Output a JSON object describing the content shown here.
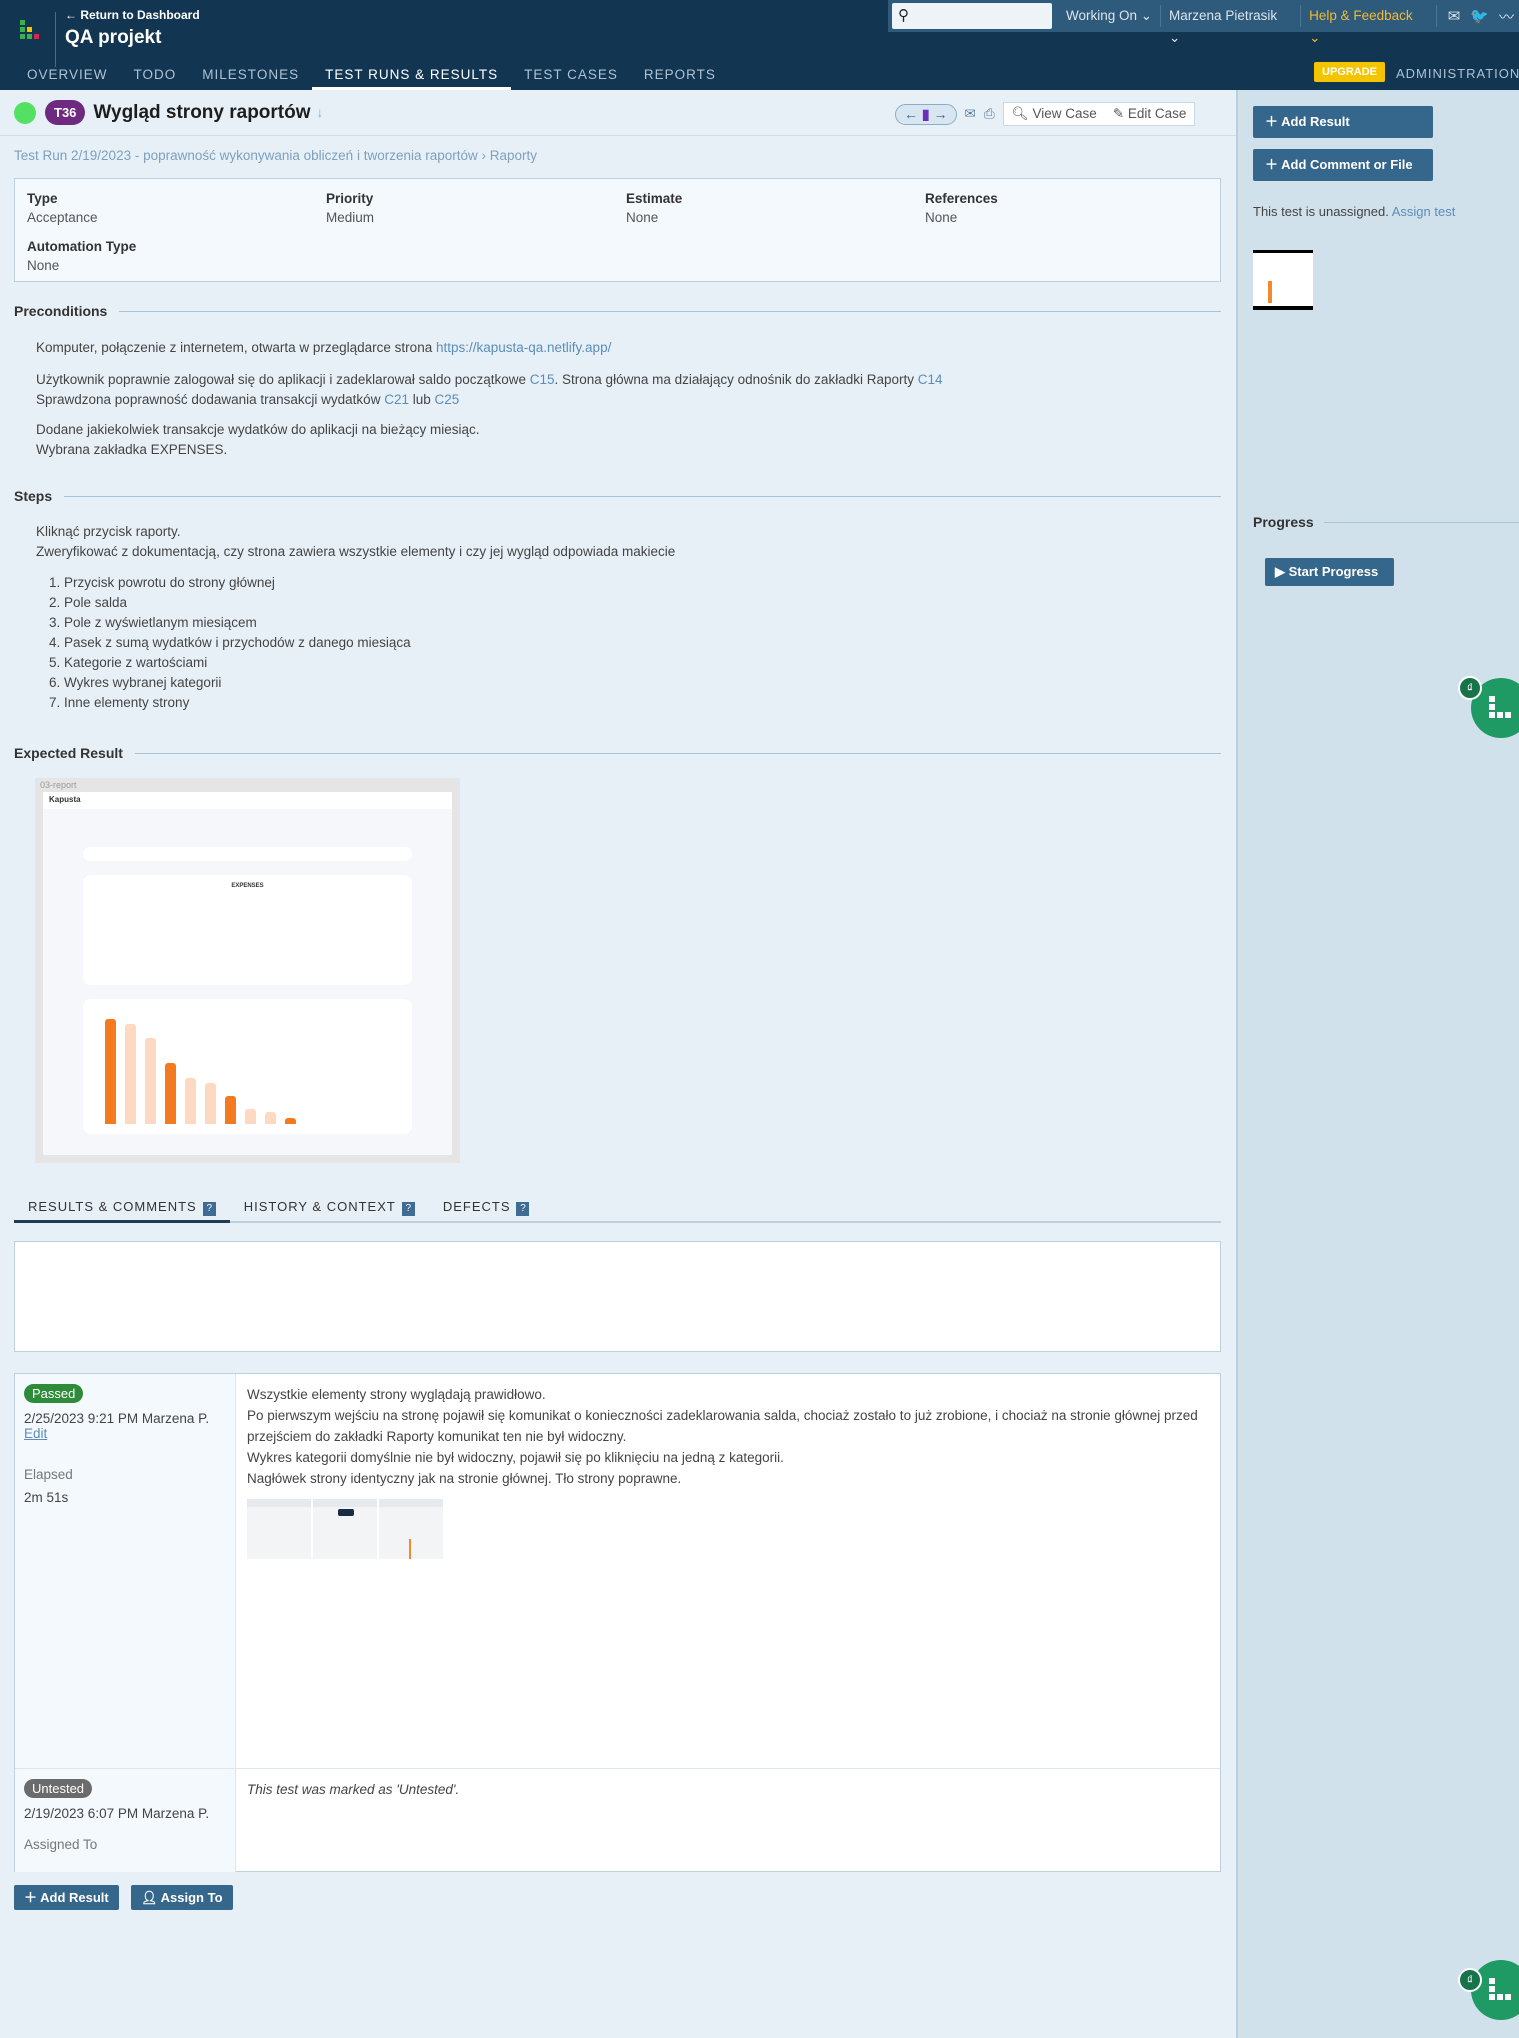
{
  "header": {
    "return_link": "← Return to Dashboard",
    "project": "QA projekt",
    "search_placeholder": "",
    "working_on": "Working On ⌄",
    "user": "Marzena Pietrasik ⌄",
    "help": "Help & Feedback ⌄",
    "upgrade": "UPGRADE",
    "administration": "ADMINISTRATION",
    "nav": [
      "OVERVIEW",
      "TODO",
      "MILESTONES",
      "TEST RUNS & RESULTS",
      "TEST CASES",
      "REPORTS"
    ]
  },
  "test": {
    "id": "T36",
    "title": "Wygląd strony raportów",
    "breadcrumb": "Test Run 2/19/2023 - poprawność wykonywania obliczeń i tworzenia raportów › Raporty",
    "view_case": "View Case",
    "edit_case": "Edit Case"
  },
  "fields": [
    {
      "label": "Type",
      "value": "Acceptance"
    },
    {
      "label": "Priority",
      "value": "Medium"
    },
    {
      "label": "Estimate",
      "value": "None"
    },
    {
      "label": "References",
      "value": "None"
    },
    {
      "label": "Automation Type",
      "value": "None"
    }
  ],
  "preconditions": {
    "heading": "Preconditions",
    "line1": "Komputer, połączenie z internetem, otwarta w przeglądarce strona ",
    "url": "https://kapusta-qa.netlify.app/",
    "line2a": "Użytkownik poprawnie zalogował się do aplikacji i zadeklarował saldo początkowe ",
    "c15": "C15",
    "line2b": ". Strona główna ma działający odnośnik do zakładki Raporty ",
    "c14": "C14",
    "line3a": "Sprawdzona poprawność dodawania transakcji wydatków ",
    "c21": "C21",
    "lub": " lub ",
    "c25": "C25",
    "line4": "Dodane jakiekolwiek transakcje wydatków do aplikacji na bieżący miesiąc.",
    "line5": "Wybrana zakładka EXPENSES."
  },
  "steps": {
    "heading": "Steps",
    "line1": "Kliknąć przycisk raporty.",
    "line2": "Zweryfikować z dokumentacją, czy strona zawiera wszystkie elementy i czy jej wygląd odpowiada makiecie",
    "items": [
      "Przycisk powrotu do strony głównej",
      "Pole salda",
      "Pole z wyświetlanym miesiącem",
      "Pasek z sumą wydatków i przychodów z danego miesiąca",
      "Kategorie z wartościami",
      "Wykres wybranej kategorii",
      "Inne elementy strony"
    ]
  },
  "expected": {
    "heading": "Expected Result",
    "image_label": "03-report",
    "logo": "Kapusta",
    "categories_title": "EXPENSES"
  },
  "tabs": [
    "RESULTS & COMMENTS",
    "HISTORY & CONTEXT",
    "DEFECTS"
  ],
  "results": [
    {
      "status": "Passed",
      "color": "#2e8b3a",
      "meta": "2/25/2023 9:21 PM Marzena P.",
      "edit": "Edit",
      "elapsed_label": "Elapsed",
      "elapsed": "2m 51s",
      "comment": [
        "Wszystkie elementy strony wyglądają prawidłowo.",
        "Po pierwszym wejściu na stronę pojawił się komunikat o konieczności zadeklarowania salda, chociaż zostało to już zrobione, i chociaż na stronie głównej przed przejściem do zakładki Raporty komunikat ten nie był widoczny.",
        "Wykres kategorii domyślnie nie był widoczny, pojawił się po kliknięciu na jedną z kategorii.",
        "Nagłówek strony identyczny jak na stronie głównej. Tło strony poprawne."
      ]
    },
    {
      "status": "Untested",
      "color": "#6b6b6b",
      "meta": "2/19/2023 6:07 PM Marzena P.",
      "assigned_label": "Assigned To",
      "comment": "This test was marked as 'Untested'."
    }
  ],
  "bottom": {
    "add_result": "Add Result",
    "assign_to": "Assign To"
  },
  "sidebar": {
    "add_result": "Add Result",
    "add_comment": "Add Comment or File",
    "unassigned": "This test is unassigned. ",
    "assign_link": "Assign test",
    "progress": "Progress",
    "start_progress": "Start Progress"
  }
}
